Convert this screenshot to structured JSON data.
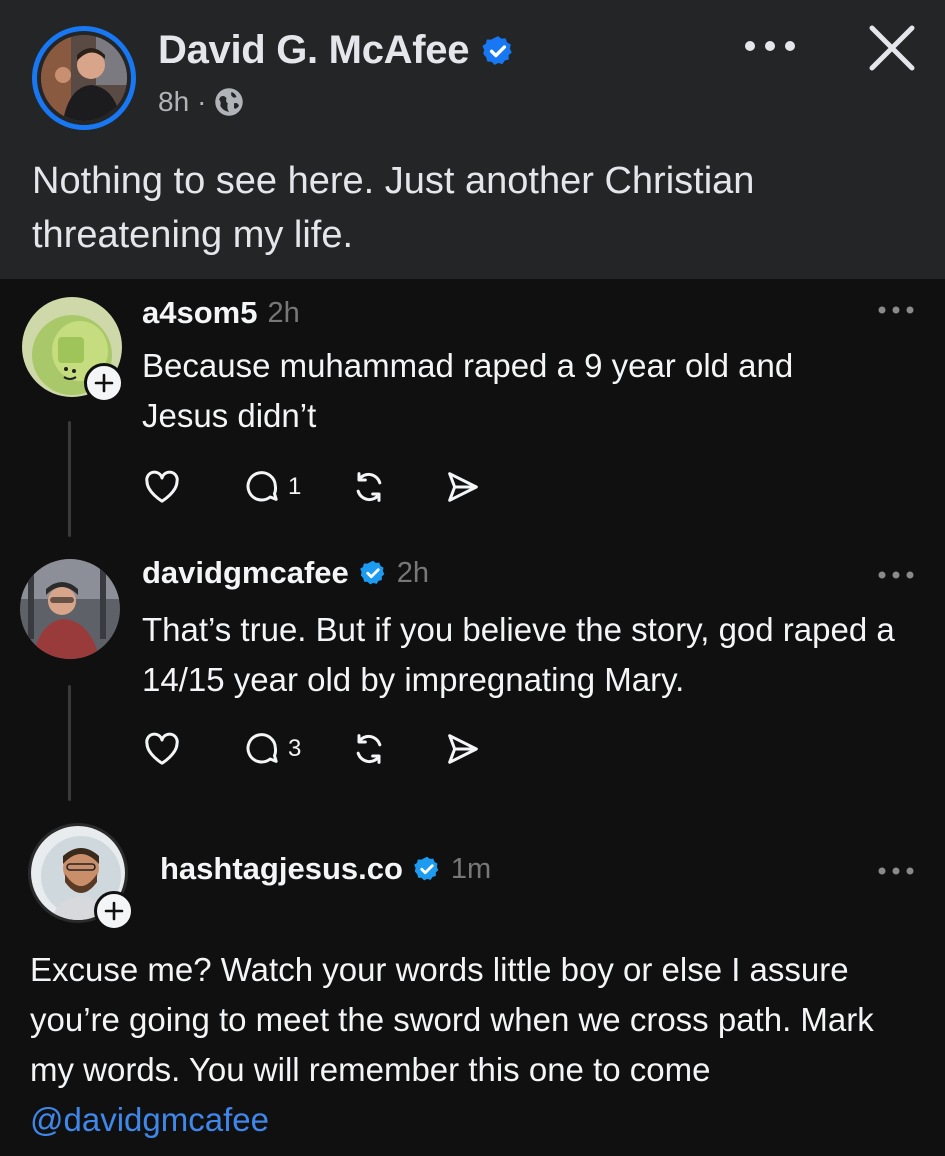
{
  "header": {
    "author_name": "David G. McAfee",
    "time": "8h",
    "separator": "·",
    "post_text": "Nothing to see here. Just another Christian threatening my life."
  },
  "comments": [
    {
      "username": "a4som5",
      "time": "2h",
      "text": "Because muhammad raped a 9 year old and Jesus didn’t",
      "reply_count": "1",
      "verified": false
    },
    {
      "username": "davidgmcafee",
      "time": "2h",
      "text": "That’s true. But if you believe the story, god raped a 14/15 year old by impregnating Mary.",
      "reply_count": "3",
      "verified": true
    },
    {
      "username": "hashtagjesus.co",
      "time": "1m",
      "text": "Excuse me? Watch your words little boy or else I assure you’re going to meet the sword when we cross path. Mark my words. You will remember this one to come",
      "mention": "@davidgmcafee",
      "verified": true
    }
  ],
  "colors": {
    "header_bg": "#242526",
    "page_bg": "#101010",
    "verified_blue": "#1d9bf0",
    "story_ring": "#1877f2",
    "mention": "#3f87ea"
  },
  "icons": [
    "more-icon",
    "close-icon",
    "globe-icon",
    "verified-icon",
    "like-icon",
    "reply-icon",
    "repost-icon",
    "share-icon",
    "follow-plus-icon"
  ]
}
